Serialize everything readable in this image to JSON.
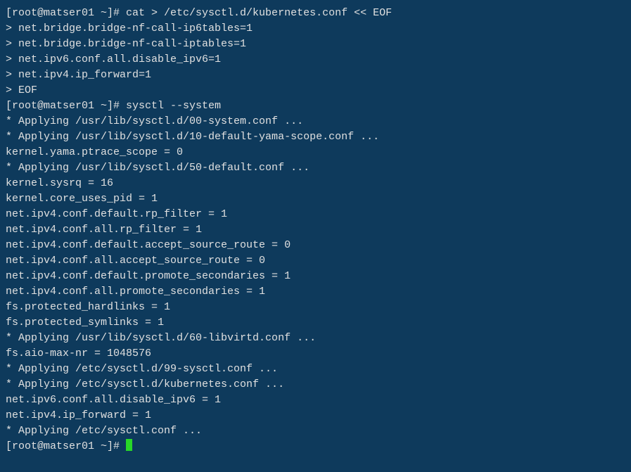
{
  "lines": [
    "[root@matser01 ~]# cat > /etc/sysctl.d/kubernetes.conf << EOF",
    "> net.bridge.bridge-nf-call-ip6tables=1",
    "> net.bridge.bridge-nf-call-iptables=1",
    "> net.ipv6.conf.all.disable_ipv6=1",
    "> net.ipv4.ip_forward=1",
    "> EOF",
    "[root@matser01 ~]# sysctl --system",
    "* Applying /usr/lib/sysctl.d/00-system.conf ...",
    "* Applying /usr/lib/sysctl.d/10-default-yama-scope.conf ...",
    "kernel.yama.ptrace_scope = 0",
    "* Applying /usr/lib/sysctl.d/50-default.conf ...",
    "kernel.sysrq = 16",
    "kernel.core_uses_pid = 1",
    "net.ipv4.conf.default.rp_filter = 1",
    "net.ipv4.conf.all.rp_filter = 1",
    "net.ipv4.conf.default.accept_source_route = 0",
    "net.ipv4.conf.all.accept_source_route = 0",
    "net.ipv4.conf.default.promote_secondaries = 1",
    "net.ipv4.conf.all.promote_secondaries = 1",
    "fs.protected_hardlinks = 1",
    "fs.protected_symlinks = 1",
    "* Applying /usr/lib/sysctl.d/60-libvirtd.conf ...",
    "fs.aio-max-nr = 1048576",
    "* Applying /etc/sysctl.d/99-sysctl.conf ...",
    "* Applying /etc/sysctl.d/kubernetes.conf ...",
    "net.ipv6.conf.all.disable_ipv6 = 1",
    "net.ipv4.ip_forward = 1",
    "* Applying /etc/sysctl.conf ...",
    "[root@matser01 ~]# "
  ]
}
